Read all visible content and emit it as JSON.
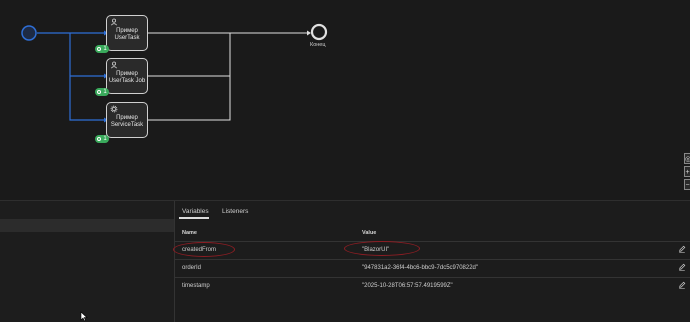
{
  "diagram": {
    "tasks": [
      {
        "label": "Пример UserTask",
        "icon": "user-icon",
        "count": "1"
      },
      {
        "label": "Пример UserTask Job",
        "icon": "user-icon",
        "count": "1"
      },
      {
        "label": "Пример ServiceTask",
        "icon": "gear-icon",
        "count": "1"
      }
    ],
    "end_label": "Конец",
    "colors": {
      "flow_active": "#2f6fd6",
      "flow": "#e0e0e0",
      "badge": "#3aaa5c"
    }
  },
  "zoom": {
    "buttons": [
      "◎",
      "+",
      "−"
    ]
  },
  "panel": {
    "tabs": [
      "Variables",
      "Listeners"
    ],
    "columns": {
      "name": "Name",
      "value": "Value"
    },
    "rows": [
      {
        "name": "createdFrom",
        "value": "\"BlazorUI\""
      },
      {
        "name": "orderId",
        "value": "\"947831a2-36f4-4bc6-bbc9-7dc5c970822d\""
      },
      {
        "name": "timestamp",
        "value": "\"2025-10-28T06:57:57.4919599Z\""
      }
    ]
  }
}
